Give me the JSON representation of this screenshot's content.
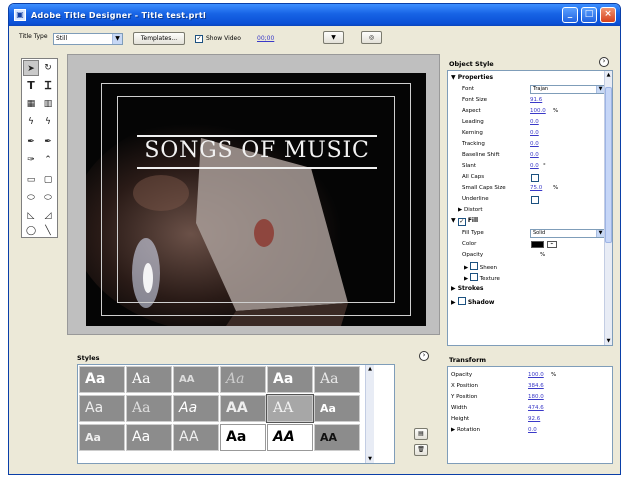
{
  "window": {
    "title": "Adobe Title Designer - Title test.prtl"
  },
  "toolbar": {
    "title_type_label": "Title Type",
    "title_type_value": "Still",
    "templates_label": "Templates...",
    "show_video_label": "Show Video",
    "timecode": "00;00"
  },
  "canvas": {
    "title_text": "SONGS OF MUSIC"
  },
  "object_style": {
    "heading": "Object Style",
    "properties_heading": "Properties",
    "rows": [
      {
        "label": "Font",
        "value": "Trajan"
      },
      {
        "label": "Font Size",
        "value": "91.6"
      },
      {
        "label": "Aspect",
        "value": "100.0",
        "unit": "%"
      },
      {
        "label": "Leading",
        "value": "0.0"
      },
      {
        "label": "Kerning",
        "value": "0.0"
      },
      {
        "label": "Tracking",
        "value": "0.0"
      },
      {
        "label": "Baseline Shift",
        "value": "0.0"
      },
      {
        "label": "Slant",
        "value": "0.0",
        "unit": "°"
      },
      {
        "label": "All Caps",
        "value": ""
      },
      {
        "label": "Small Caps Size",
        "value": "75.0",
        "unit": "%"
      },
      {
        "label": "Underline",
        "value": ""
      }
    ],
    "distort_label": "Distort",
    "fill_heading": "Fill",
    "fill_rows": [
      {
        "label": "Fill Type",
        "value": "Solid"
      },
      {
        "label": "Color",
        "value": ""
      },
      {
        "label": "Opacity",
        "value": "",
        "unit": "%"
      }
    ],
    "sheen_label": "Sheen",
    "texture_label": "Texture",
    "strokes_label": "Strokes",
    "shadow_label": "Shadow"
  },
  "styles": {
    "heading": "Styles",
    "cells": [
      "Aa",
      "Aa",
      "AA",
      "Aa",
      "Aa",
      "Aa",
      "Aa",
      "Aa",
      "Aa",
      "AA",
      "AA",
      "Aa",
      "Aa",
      "Aa",
      "AA",
      "Aa",
      "AA",
      "AA"
    ]
  },
  "transform": {
    "heading": "Transform",
    "rows": [
      {
        "label": "Opacity",
        "value": "100.0",
        "unit": "%"
      },
      {
        "label": "X Position",
        "value": "384.6"
      },
      {
        "label": "Y Position",
        "value": "180.0"
      },
      {
        "label": "Width",
        "value": "474.6"
      },
      {
        "label": "Height",
        "value": "92.6"
      },
      {
        "label": "Rotation",
        "value": "0.0"
      }
    ]
  },
  "colors": {
    "accent_link": "#3a39c8",
    "titlebar": "#0a4fd6",
    "panel_bg": "#ece9d8"
  }
}
